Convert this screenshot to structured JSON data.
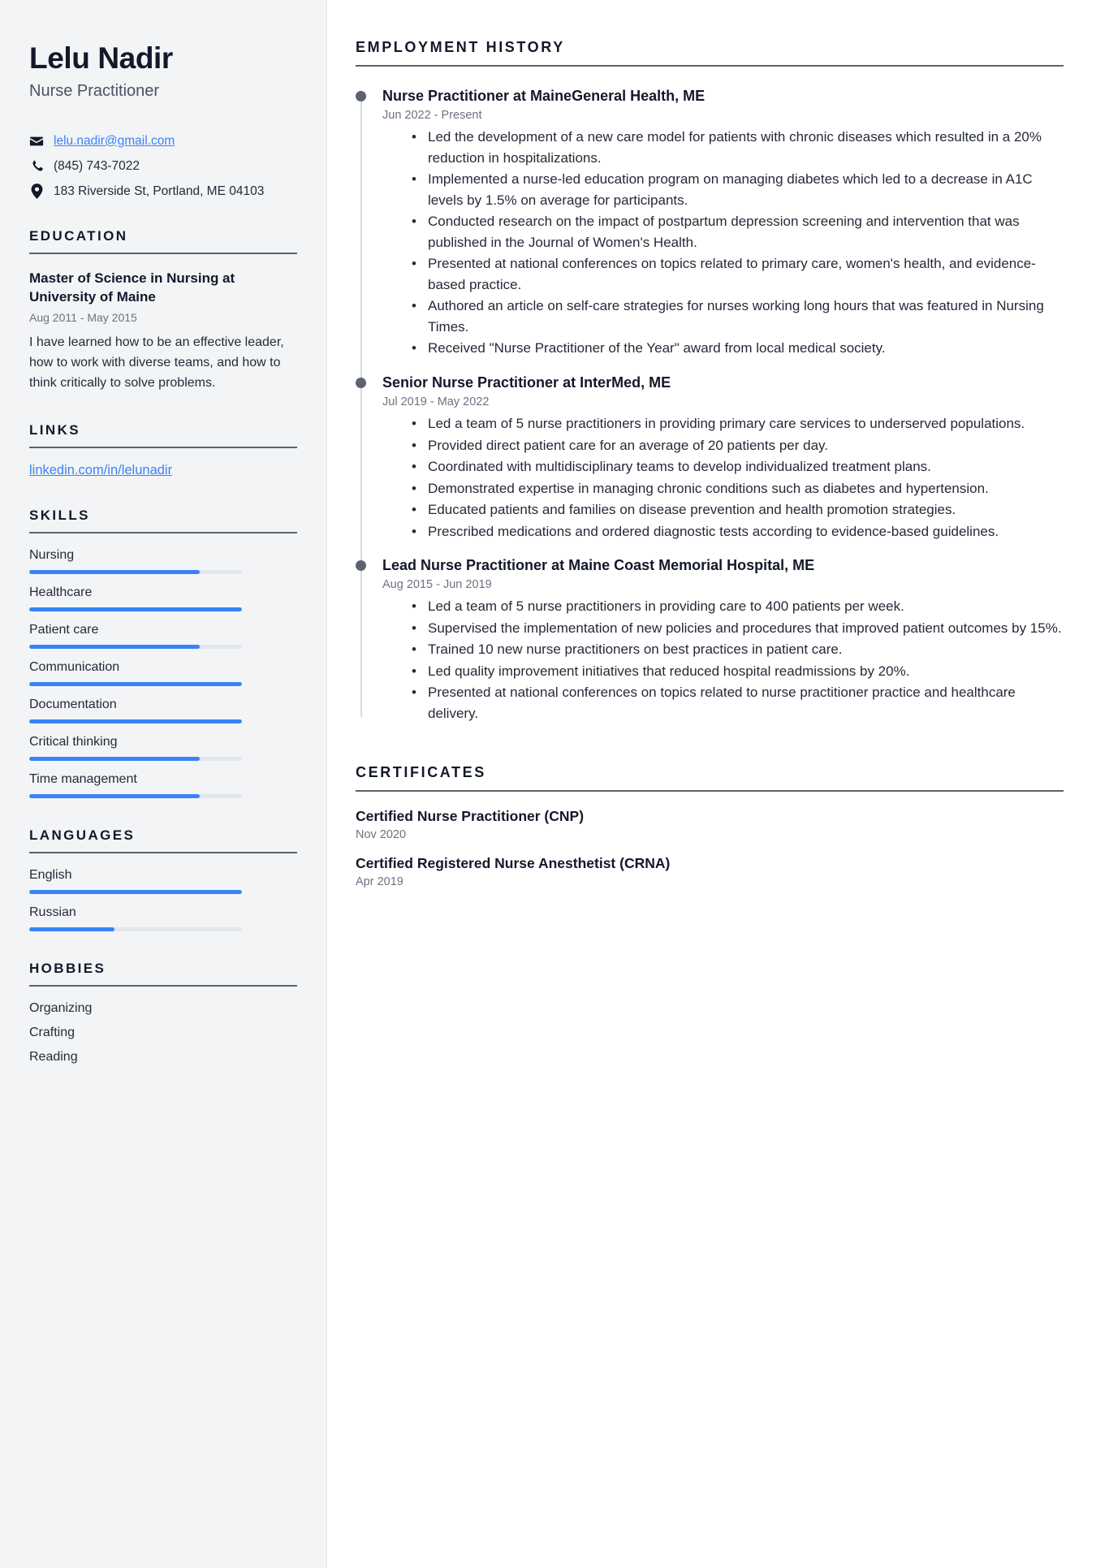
{
  "sidebar": {
    "name": "Lelu Nadir",
    "job_title": "Nurse Practitioner",
    "contact": {
      "email": "lelu.nadir@gmail.com",
      "phone": "(845) 743-7022",
      "address": "183 Riverside St, Portland, ME 04103",
      "email_icon": "envelope-icon",
      "phone_icon": "phone-icon",
      "address_icon": "map-pin-icon"
    },
    "education": {
      "heading": "EDUCATION",
      "degree": "Master of Science in Nursing at University of Maine",
      "date": "Aug 2011 - May 2015",
      "description": "I have learned how to be an effective leader, how to work with diverse teams, and how to think critically to solve problems."
    },
    "links": {
      "heading": "LINKS",
      "items": [
        {
          "label": "linkedin.com/in/lelunadir"
        }
      ]
    },
    "skills": {
      "heading": "SKILLS",
      "items": [
        {
          "label": "Nursing",
          "level": 80
        },
        {
          "label": "Healthcare",
          "level": 100
        },
        {
          "label": "Patient care",
          "level": 80
        },
        {
          "label": "Communication",
          "level": 100
        },
        {
          "label": "Documentation",
          "level": 100
        },
        {
          "label": "Critical thinking",
          "level": 80
        },
        {
          "label": "Time management",
          "level": 80
        }
      ]
    },
    "languages": {
      "heading": "LANGUAGES",
      "items": [
        {
          "label": "English",
          "level": 100
        },
        {
          "label": "Russian",
          "level": 40
        }
      ]
    },
    "hobbies": {
      "heading": "HOBBIES",
      "items": [
        {
          "label": "Organizing"
        },
        {
          "label": "Crafting"
        },
        {
          "label": "Reading"
        }
      ]
    }
  },
  "main": {
    "employment": {
      "heading": "EMPLOYMENT HISTORY",
      "jobs": [
        {
          "role": "Nurse Practitioner at MaineGeneral Health, ME",
          "date": "Jun 2022 - Present",
          "bullets": [
            "Led the development of a new care model for patients with chronic diseases which resulted in a 20% reduction in hospitalizations.",
            "Implemented a nurse-led education program on managing diabetes which led to a decrease in A1C levels by 1.5% on average for participants.",
            "Conducted research on the impact of postpartum depression screening and intervention that was published in the Journal of Women's Health.",
            "Presented at national conferences on topics related to primary care, women's health, and evidence-based practice.",
            "Authored an article on self-care strategies for nurses working long hours that was featured in Nursing Times.",
            "Received \"Nurse Practitioner of the Year\" award from local medical society."
          ]
        },
        {
          "role": "Senior Nurse Practitioner at InterMed, ME",
          "date": "Jul 2019 - May 2022",
          "bullets": [
            "Led a team of 5 nurse practitioners in providing primary care services to underserved populations.",
            "Provided direct patient care for an average of 20 patients per day.",
            "Coordinated with multidisciplinary teams to develop individualized treatment plans.",
            "Demonstrated expertise in managing chronic conditions such as diabetes and hypertension.",
            "Educated patients and families on disease prevention and health promotion strategies.",
            "Prescribed medications and ordered diagnostic tests according to evidence-based guidelines."
          ]
        },
        {
          "role": "Lead Nurse Practitioner at Maine Coast Memorial Hospital, ME",
          "date": "Aug 2015 - Jun 2019",
          "bullets": [
            "Led a team of 5 nurse practitioners in providing care to 400 patients per week.",
            "Supervised the implementation of new policies and procedures that improved patient outcomes by 15%.",
            "Trained 10 new nurse practitioners on best practices in patient care.",
            "Led quality improvement initiatives that reduced hospital readmissions by 20%.",
            "Presented at national conferences on topics related to nurse practitioner practice and healthcare delivery."
          ]
        }
      ]
    },
    "certificates": {
      "heading": "CERTIFICATES",
      "items": [
        {
          "name": "Certified Nurse Practitioner (CNP)",
          "date": "Nov 2020"
        },
        {
          "name": "Certified Registered Nurse Anesthetist (CRNA)",
          "date": "Apr 2019"
        }
      ]
    }
  },
  "colors": {
    "accent": "#3b82f6",
    "sidebar_bg": "#f2f4f6",
    "heading": "#13182a",
    "muted": "#6b7280",
    "rule": "#5b6270"
  }
}
